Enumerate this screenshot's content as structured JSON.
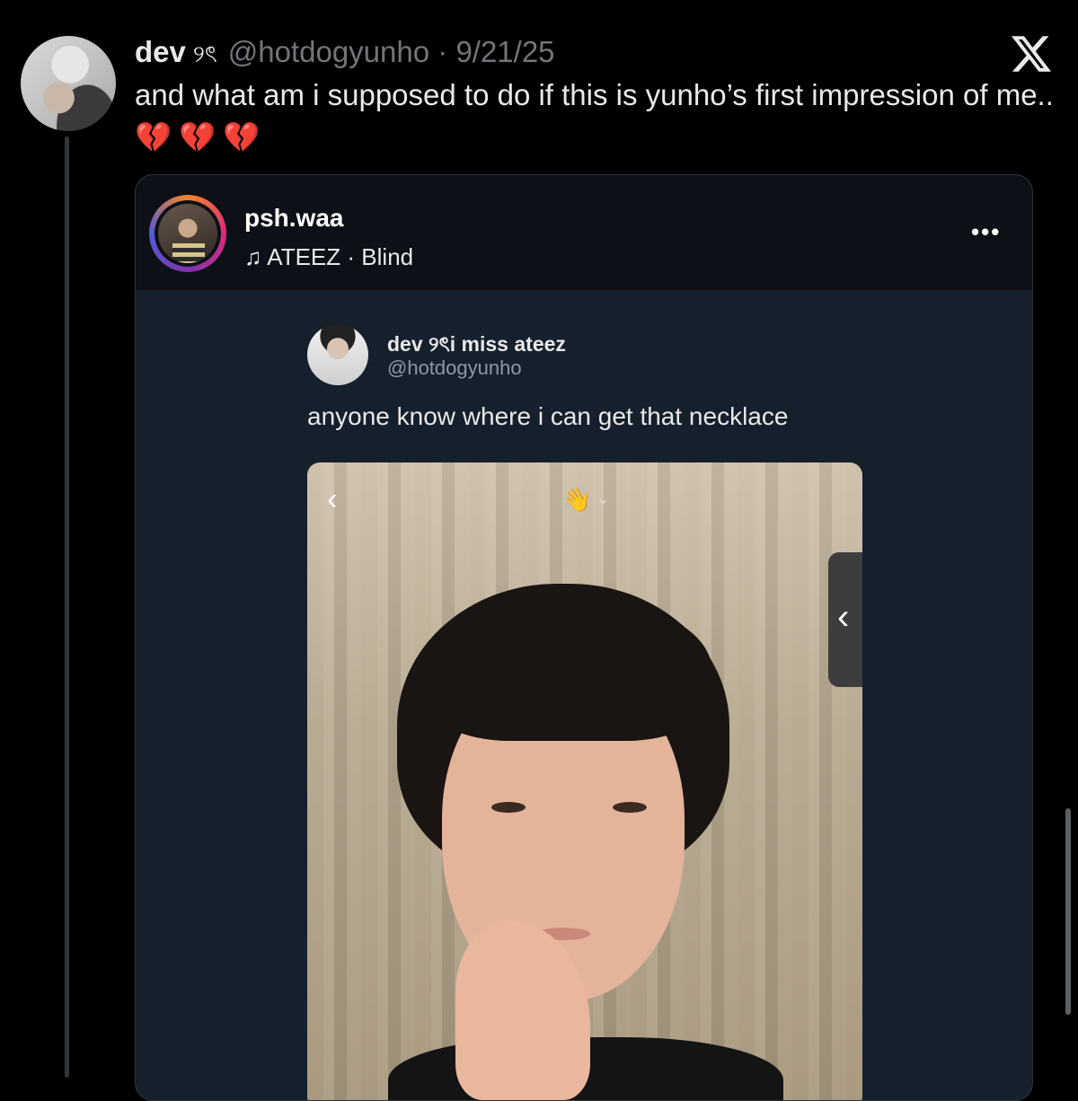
{
  "tweet": {
    "display_name": "dev",
    "name_glyph": "୨ৎ",
    "handle": "@hotdogyunho",
    "separator": "·",
    "date": "9/21/25",
    "text": "and what am i supposed to do if this is yunho’s first impression of me..",
    "emojis": "💔💔💔"
  },
  "instagram_post": {
    "username": "psh.waa",
    "music_icon": "♫",
    "music_artist": "ATEEZ",
    "music_separator": "·",
    "music_song": "Blind",
    "more_label": "•••",
    "embedded_tweet": {
      "display_name": "dev ୨ৎi miss ateez",
      "handle": "@hotdogyunho",
      "text": "anyone know where i can get that necklace"
    },
    "photo_overlay": {
      "back_glyph": "‹",
      "wave_emoji": "👋",
      "chevron": "⌄",
      "side_tab_glyph": "‹"
    }
  },
  "icons": {
    "x_logo": "x-logo-icon",
    "music": "music-note-icon",
    "more": "more-dots-icon"
  },
  "colors": {
    "background": "#000000",
    "text": "#e7e9ea",
    "muted": "#71767b",
    "card": "#16202c",
    "heart": "#e0245e"
  }
}
